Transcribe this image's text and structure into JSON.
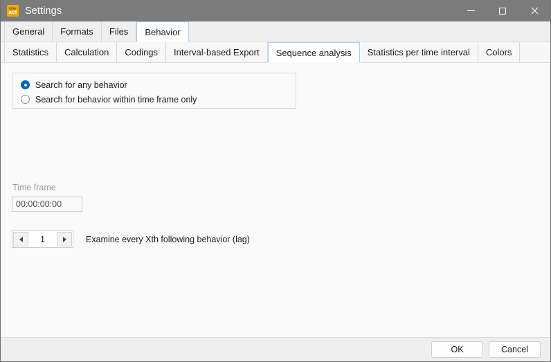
{
  "window": {
    "title": "Settings",
    "icon_name": "interact-logo-icon",
    "icon_line1": "inter",
    "icon_line2": "ACT",
    "icon_color": "#f0a800",
    "titlebar_color": "#7b7b7b",
    "controls": {
      "minimize": "minimize-icon",
      "maximize": "maximize-icon",
      "close": "close-icon"
    }
  },
  "primary_tabs": {
    "selected": "Behavior",
    "items": [
      {
        "label": "General"
      },
      {
        "label": "Formats"
      },
      {
        "label": "Files"
      },
      {
        "label": "Behavior"
      }
    ]
  },
  "secondary_tabs": {
    "selected": "Sequence analysis",
    "items": [
      {
        "label": "Statistics"
      },
      {
        "label": "Calculation"
      },
      {
        "label": "Codings"
      },
      {
        "label": "Interval-based Export"
      },
      {
        "label": "Sequence analysis"
      },
      {
        "label": "Statistics per time interval"
      },
      {
        "label": "Colors"
      }
    ]
  },
  "search_mode": {
    "selected_index": 0,
    "options": [
      {
        "label": "Search for any behavior",
        "checked": true
      },
      {
        "label": "Search for behavior within time frame only",
        "checked": false
      }
    ]
  },
  "time_frame": {
    "label": "Time frame",
    "value": "00:00:00:00",
    "placeholder": "00:00:00:00",
    "disabled": true
  },
  "lag": {
    "value": "1",
    "caption": "Examine every Xth following behavior (lag)",
    "decrement_icon": "triangle-left-icon",
    "increment_icon": "triangle-right-icon"
  },
  "footer": {
    "ok_label": "OK",
    "cancel_label": "Cancel"
  },
  "colors": {
    "accent": "#0067c0",
    "titlebar": "#7b7b7b",
    "content_bg": "#fafafa",
    "footer_bg": "#efefef",
    "tab_selected_border": "#a7cdf0"
  }
}
